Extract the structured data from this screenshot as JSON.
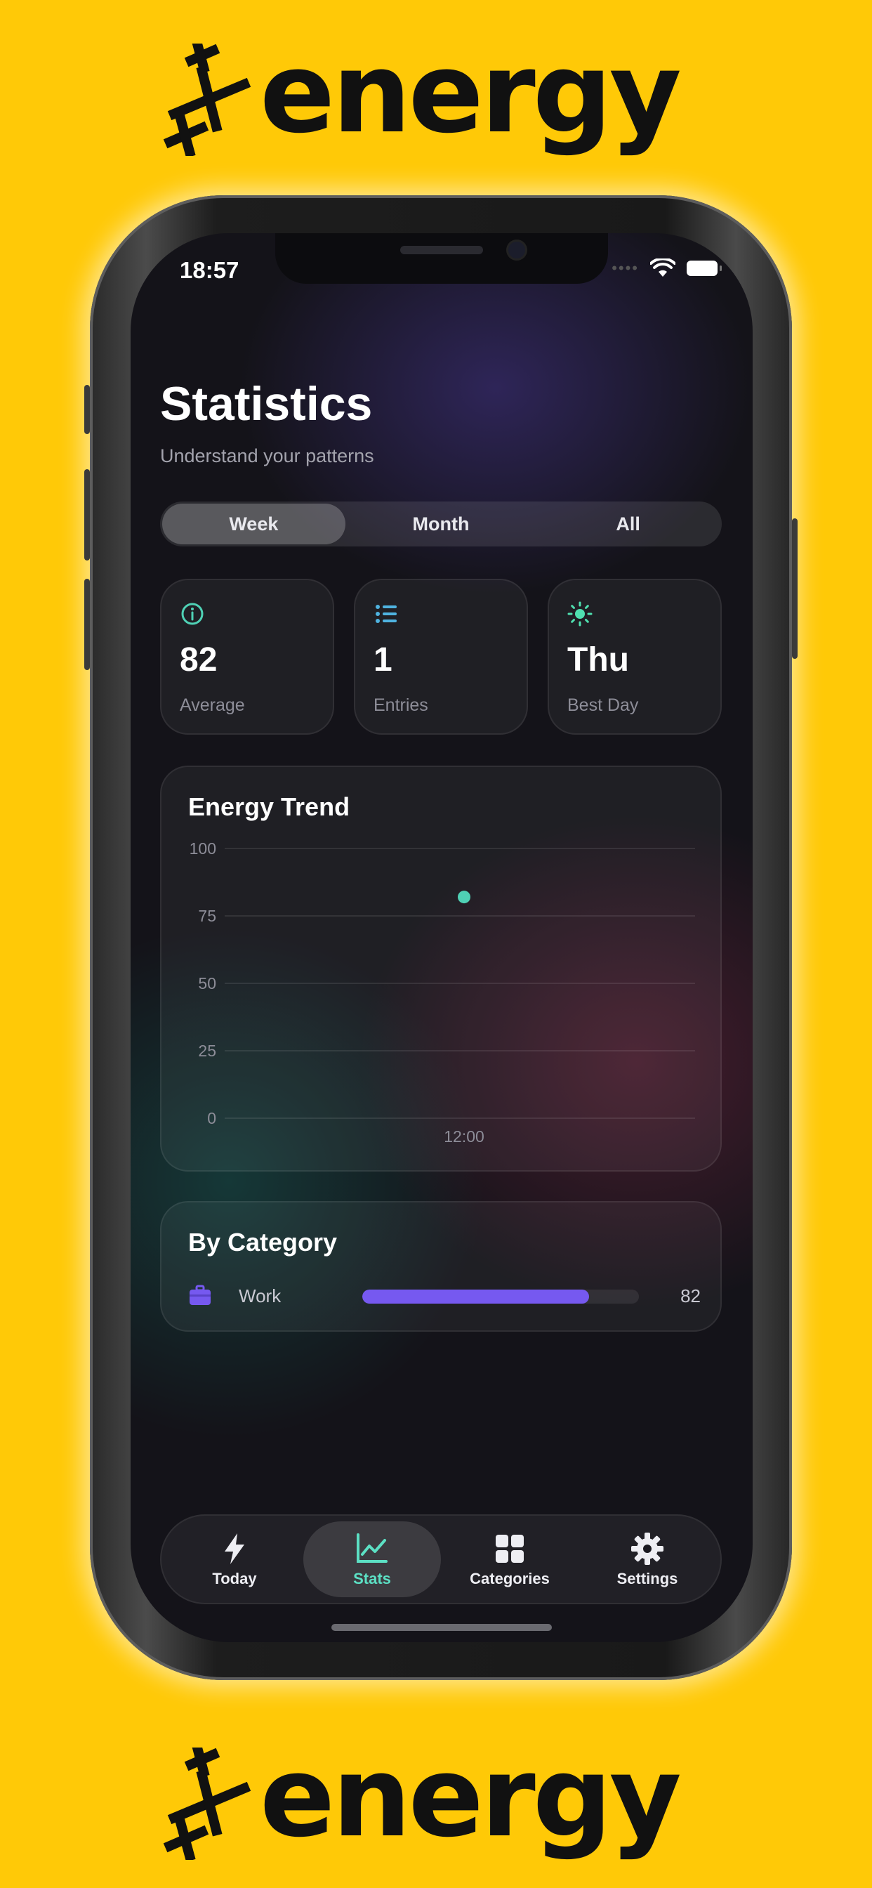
{
  "brand": {
    "wordmark": "energy"
  },
  "status_bar": {
    "time": "18:57"
  },
  "header": {
    "title": "Statistics",
    "subtitle": "Understand your patterns"
  },
  "period_tabs": {
    "items": [
      {
        "label": "Week",
        "active": true
      },
      {
        "label": "Month",
        "active": false
      },
      {
        "label": "All",
        "active": false
      }
    ]
  },
  "stats": [
    {
      "value": "82",
      "label": "Average",
      "icon": "info-icon",
      "color": "#4fd1b5"
    },
    {
      "value": "1",
      "label": "Entries",
      "icon": "list-icon",
      "color": "#4fb3e0"
    },
    {
      "value": "Thu",
      "label": "Best Day",
      "icon": "sun-icon",
      "color": "#4fe0b0"
    }
  ],
  "trend": {
    "title": "Energy Trend"
  },
  "chart_data": {
    "type": "scatter",
    "title": "Energy Trend",
    "x_ticks": [
      "12:00"
    ],
    "y_ticks": [
      "100",
      "75",
      "50",
      "25",
      "0"
    ],
    "ylim": [
      0,
      100
    ],
    "points": [
      {
        "x": "12:00",
        "y": 82
      }
    ],
    "grid": true,
    "color": "#4fd1b5"
  },
  "by_category": {
    "title": "By Category",
    "items": [
      {
        "name": "Work",
        "value": "82",
        "fraction": 0.82,
        "icon": "briefcase-icon",
        "color": "#7659f0"
      }
    ]
  },
  "tabbar": {
    "items": [
      {
        "label": "Today",
        "icon": "bolt-icon",
        "active": false
      },
      {
        "label": "Stats",
        "icon": "chart-icon",
        "active": true
      },
      {
        "label": "Categories",
        "icon": "grid-icon",
        "active": false
      },
      {
        "label": "Settings",
        "icon": "gear-icon",
        "active": false
      }
    ]
  }
}
